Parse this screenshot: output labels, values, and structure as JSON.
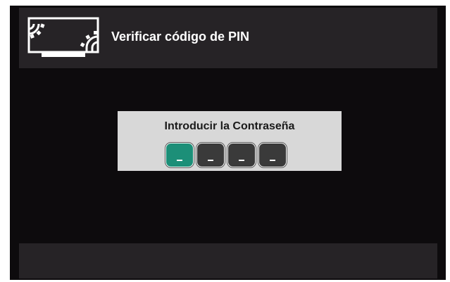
{
  "header": {
    "title": "Verificar código de PIN",
    "icon": "settings-display-icon"
  },
  "dialog": {
    "title": "Introducir la Contraseña",
    "pin_slots": [
      {
        "value": "_",
        "active": true
      },
      {
        "value": "_",
        "active": false
      },
      {
        "value": "_",
        "active": false
      },
      {
        "value": "_",
        "active": false
      }
    ]
  },
  "colors": {
    "background": "#0d0b0d",
    "panel": "#262326",
    "dialog": "#d8d8d8",
    "accent": "#1c8f78"
  }
}
